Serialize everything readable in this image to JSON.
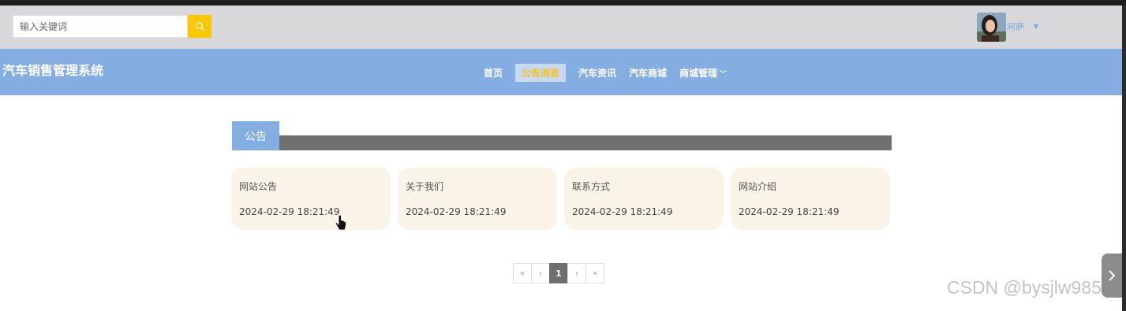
{
  "search": {
    "placeholder": "输入关键词"
  },
  "user": {
    "name": "阿萨"
  },
  "site": {
    "title": "汽车销售管理系统"
  },
  "nav": {
    "items": [
      {
        "label": "首页",
        "active": false
      },
      {
        "label": "公告消息",
        "active": true
      },
      {
        "label": "汽车资讯",
        "active": false
      },
      {
        "label": "汽车商城",
        "active": false
      },
      {
        "label": "商城管理",
        "active": false,
        "has_dropdown": true
      }
    ]
  },
  "section": {
    "title": "公告"
  },
  "cards": [
    {
      "title": "网站公告",
      "date": "2024-02-29 18:21:49"
    },
    {
      "title": "关于我们",
      "date": "2024-02-29 18:21:49"
    },
    {
      "title": "联系方式",
      "date": "2024-02-29 18:21:49"
    },
    {
      "title": "网站介绍",
      "date": "2024-02-29 18:21:49"
    }
  ],
  "pagination": {
    "first": "«",
    "prev": "‹",
    "current": "1",
    "next": "›",
    "last": "»"
  },
  "watermark": "CSDN @bysjlw985",
  "colors": {
    "nav_bg": "#84aee1",
    "accent_yellow": "#fcc700",
    "card_bg": "#faf3e8",
    "section_bar": "#707070"
  },
  "icons": {
    "search": "search-icon",
    "dropdown": "chevron-down-icon",
    "side": "chevron-right-icon"
  }
}
